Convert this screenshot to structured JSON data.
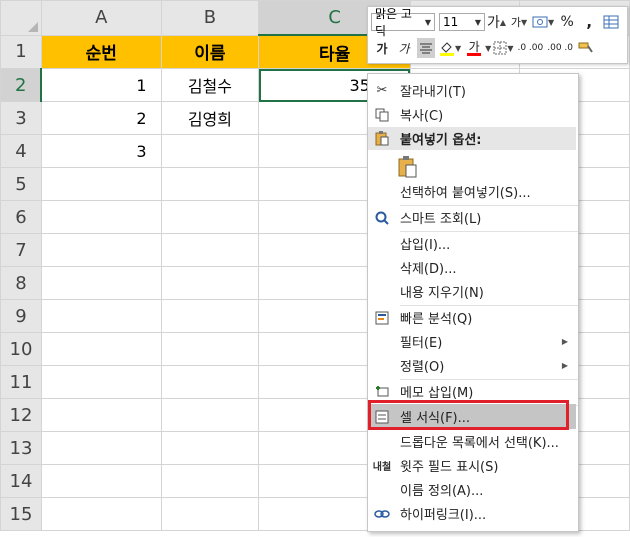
{
  "columns": [
    "A",
    "B",
    "C"
  ],
  "rows": [
    "1",
    "2",
    "3",
    "4",
    "5",
    "6",
    "7",
    "8",
    "9",
    "10",
    "11",
    "12",
    "13",
    "14",
    "15"
  ],
  "table": {
    "headers": [
      "순번",
      "이름",
      "타율"
    ],
    "data": [
      [
        "1",
        "김철수",
        "35"
      ],
      [
        "2",
        "김영희",
        ""
      ],
      [
        "3",
        "",
        ""
      ]
    ]
  },
  "mini_toolbar": {
    "font_name": "맑은 고딕",
    "font_size": "11",
    "grow_font": "가",
    "shrink_font": "가",
    "percent": "%",
    "comma": ",",
    "bold": "가",
    "italic": "가",
    "font_color_letter": "가",
    "dec_inc": ".0 .00",
    "dec_dec": ".00 .0",
    "colors": {
      "fill": "#ffff00",
      "font": "#ff0000"
    }
  },
  "context_menu": {
    "cut": "잘라내기(T)",
    "copy": "복사(C)",
    "paste_options": "붙여넣기 옵션:",
    "paste_special": "선택하여 붙여넣기(S)...",
    "smart_lookup": "스마트 조회(L)",
    "insert": "삽입(I)...",
    "delete": "삭제(D)...",
    "clear_contents": "내용 지우기(N)",
    "quick_analysis": "빠른 분석(Q)",
    "filter": "필터(E)",
    "sort": "정렬(O)",
    "insert_comment": "메모 삽입(M)",
    "format_cells": "셀 서식(F)...",
    "pick_from_list": "드롭다운 목록에서 선택(K)...",
    "phonetic": "윗주 필드 표시(S)",
    "define_name": "이름 정의(A)...",
    "hyperlink": "하이퍼링크(I)..."
  },
  "colors": {
    "header_fill": "#ffc000",
    "selection_green": "#217346",
    "highlight_red": "#e0202a"
  }
}
